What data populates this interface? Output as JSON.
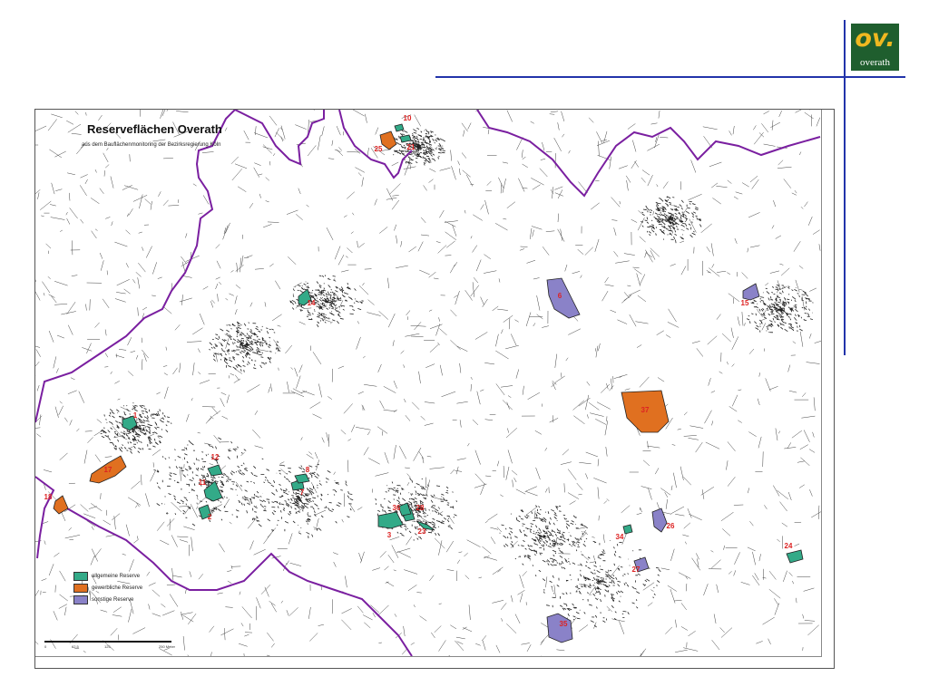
{
  "logo": {
    "mark": "ov.",
    "word": "overath",
    "bg_color": "#1f5e2e",
    "mark_color": "#f0b820"
  },
  "map": {
    "title": "Reserveflächen Overath",
    "subtitle": "aus dem Bauflächenmonitoring der Bezirksregierung Köln",
    "legend": [
      {
        "label": "allgemeine Reserve",
        "color": "#33aa88"
      },
      {
        "label": "gewerbliche Reserve",
        "color": "#e07020"
      },
      {
        "label": "sonstige Reserve",
        "color": "#8a82c8"
      }
    ],
    "scale_ticks": [
      "0",
      "62,5",
      "125",
      "250 Meter"
    ],
    "boundary_color": "#7a1fa0",
    "parcel_label_color": "#dd2222",
    "parcels": [
      {
        "label": "1",
        "category": "allgemeine Reserve"
      },
      {
        "label": "2",
        "category": "allgemeine Reserve"
      },
      {
        "label": "3",
        "category": "allgemeine Reserve"
      },
      {
        "label": "6",
        "category": "sonstige Reserve"
      },
      {
        "label": "7",
        "category": "allgemeine Reserve"
      },
      {
        "label": "8",
        "category": "allgemeine Reserve"
      },
      {
        "label": "10",
        "category": "allgemeine Reserve"
      },
      {
        "label": "11",
        "category": "allgemeine Reserve"
      },
      {
        "label": "12",
        "category": "allgemeine Reserve"
      },
      {
        "label": "14",
        "category": "allgemeine Reserve"
      },
      {
        "label": "15",
        "category": "sonstige Reserve"
      },
      {
        "label": "17",
        "category": "gewerbliche Reserve"
      },
      {
        "label": "18",
        "category": "gewerbliche Reserve"
      },
      {
        "label": "21",
        "category": "allgemeine Reserve"
      },
      {
        "label": "23",
        "category": "allgemeine Reserve"
      },
      {
        "label": "24",
        "category": "allgemeine Reserve"
      },
      {
        "label": "25",
        "category": "gewerbliche Reserve"
      },
      {
        "label": "26",
        "category": "sonstige Reserve"
      },
      {
        "label": "27",
        "category": "sonstige Reserve"
      },
      {
        "label": "28",
        "category": "allgemeine Reserve"
      },
      {
        "label": "34",
        "category": "allgemeine Reserve"
      },
      {
        "label": "35",
        "category": "sonstige Reserve"
      },
      {
        "label": "36",
        "category": "allgemeine Reserve"
      },
      {
        "label": "37",
        "category": "gewerbliche Reserve"
      }
    ]
  }
}
